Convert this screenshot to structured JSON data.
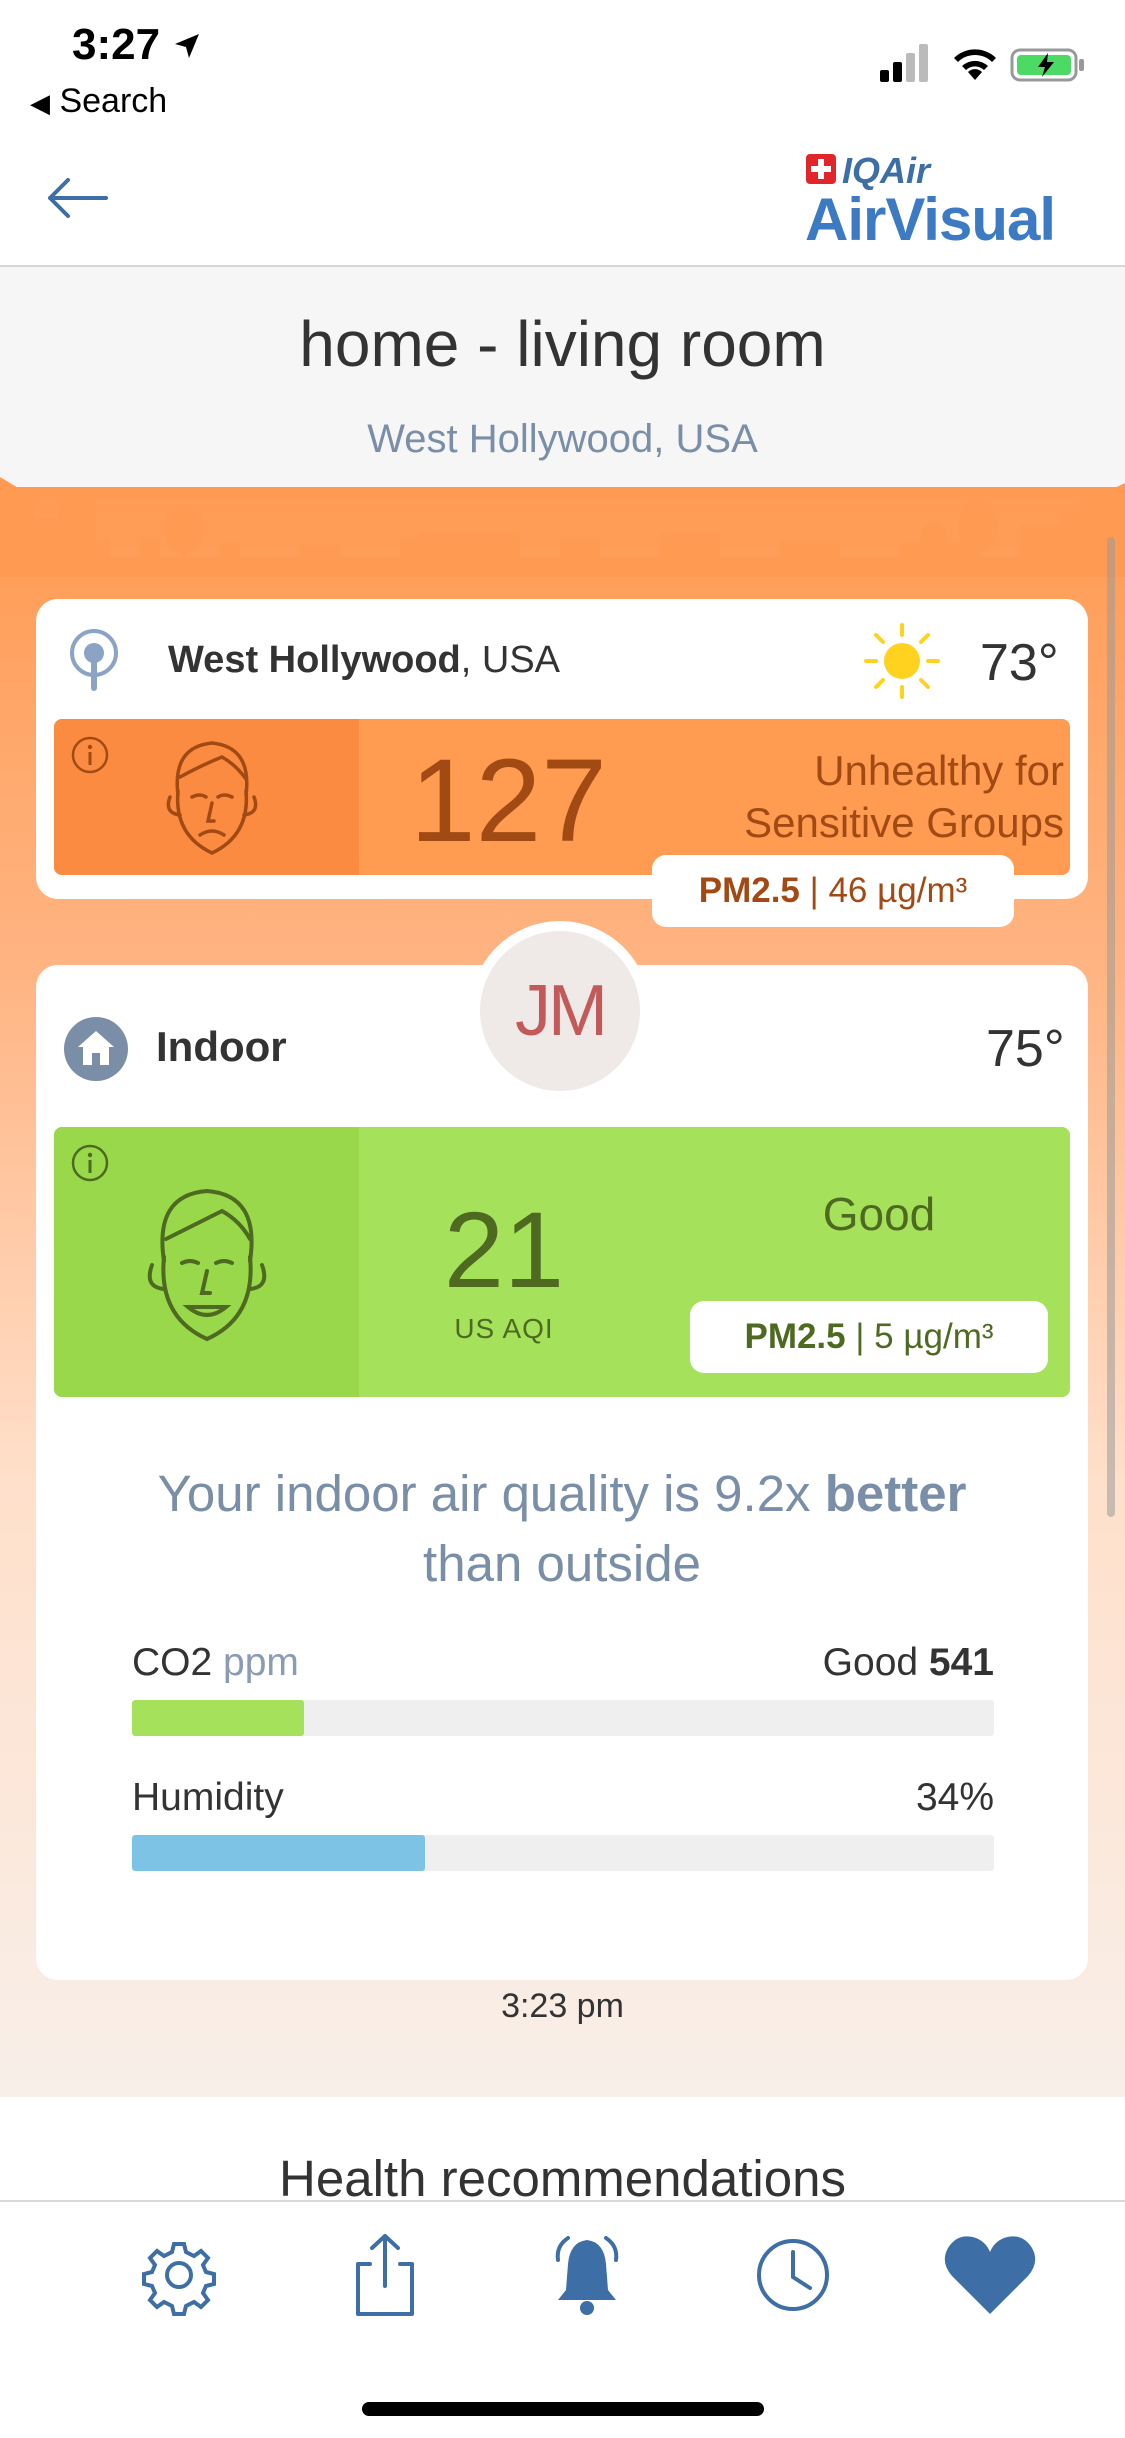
{
  "status_bar": {
    "time": "3:27",
    "back_app": "Search"
  },
  "header": {
    "logo_top": "IQAir",
    "logo_main": "AirVisual"
  },
  "device": {
    "title": "home - living room",
    "location": "West Hollywood, USA"
  },
  "outdoor": {
    "city": "West Hollywood",
    "country": ", USA",
    "weather_icon": "sun-icon",
    "temperature": "73°",
    "aqi": "127",
    "status_line1": "Unhealthy for",
    "status_line2": "Sensitive Groups",
    "pm_label": "PM2.5",
    "pm_value": "| 46 µg/m³",
    "color": "#ff9c52"
  },
  "indoor": {
    "label": "Indoor",
    "avatar_initials": "JM",
    "temperature": "75°",
    "aqi": "21",
    "aqi_unit": "US AQI",
    "status": "Good",
    "pm_label": "PM2.5",
    "pm_value": "| 5 µg/m³",
    "color": "#a6e15c",
    "comparison_prefix": "Your indoor air quality is 9.2x ",
    "comparison_bold": "better",
    "comparison_suffix": "than outside",
    "co2_label": "CO2",
    "co2_unit": "ppm",
    "co2_status": "Good",
    "co2_value": "541",
    "co2_fraction": 0.2,
    "humidity_label": "Humidity",
    "humidity_value": "34%",
    "humidity_fraction": 0.34,
    "updated_time": "3:23 pm"
  },
  "health": {
    "title": "Health recommendations"
  },
  "tabs": [
    "gear-icon",
    "share-icon",
    "bell-icon",
    "clock-icon",
    "heart-icon"
  ]
}
